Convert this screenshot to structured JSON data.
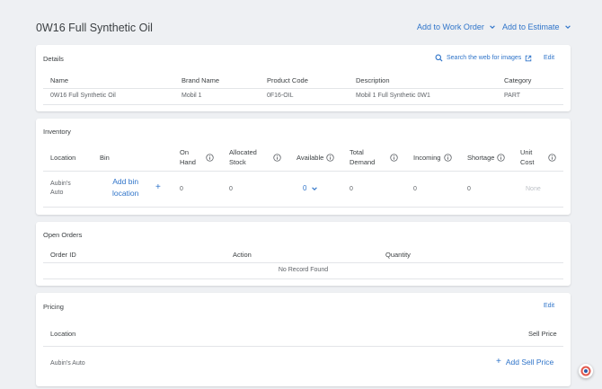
{
  "header": {
    "title": "0W16 Full Synthetic Oil",
    "add_to_work_order": "Add to Work Order",
    "add_to_estimate": "Add to Estimate"
  },
  "details": {
    "title": "Details",
    "search_web": "Search the web for images",
    "edit": "Edit",
    "columns": [
      "Name",
      "Brand Name",
      "Product Code",
      "Description",
      "Category"
    ],
    "row": [
      "0W16 Full Synthetic Oil",
      "Mobil 1",
      "0F16-OIL",
      "Mobil 1 Full Synthetic 0W1",
      "PART"
    ]
  },
  "inventory": {
    "title": "Inventory",
    "columns": {
      "location": "Location",
      "bin": "Bin",
      "on_hand_1": "On",
      "on_hand_2": "Hand",
      "allocated_1": "Allocated",
      "allocated_2": "Stock",
      "available": "Available",
      "total_demand_1": "Total",
      "total_demand_2": "Demand",
      "incoming": "Incoming",
      "shortage": "Shortage",
      "unit_cost_1": "Unit",
      "unit_cost_2": "Cost"
    },
    "row": {
      "location_1": "Aubin's",
      "location_2": "Auto",
      "add_bin_1": "Add bin",
      "add_bin_2": "location",
      "add_symbol": "+",
      "on_hand": "0",
      "allocated": "0",
      "available": "0",
      "total_demand": "0",
      "incoming": "0",
      "shortage": "0",
      "unit_cost": "None"
    }
  },
  "open_orders": {
    "title": "Open Orders",
    "columns": [
      "Order ID",
      "Action",
      "Quantity"
    ],
    "empty": "No Record Found"
  },
  "pricing": {
    "title": "Pricing",
    "edit": "Edit",
    "columns": {
      "location": "Location",
      "sell_price": "Sell Price"
    },
    "row": {
      "location": "Aubin's Auto",
      "add_symbol": "+",
      "add_sell_price": "Add Sell Price"
    }
  },
  "colors": {
    "accent": "#2f74c9",
    "text": "#3c4043",
    "background": "#eef0f3"
  },
  "icons": [
    "chevron-down-icon",
    "search-icon",
    "external-link-icon",
    "info-icon",
    "plus-icon",
    "help-badge-icon"
  ]
}
